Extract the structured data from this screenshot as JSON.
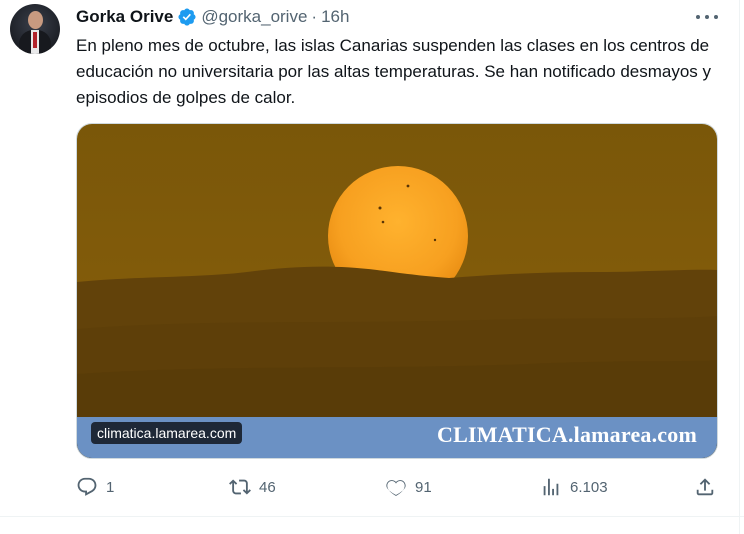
{
  "tweet": {
    "author_name": "Gorka Orive",
    "handle": "@gorka_orive",
    "separator": "·",
    "time": "16h",
    "text": "En pleno mes de octubre, las islas Canarias suspenden las clases en los centros de educación no universitaria por las altas temperaturas. Se han notificado desmayos y episodios de golpes de calor.",
    "verified": true
  },
  "media": {
    "domain_label": "climatica.lamarea.com",
    "brand_text": "CLIMATICA.lamarea.com",
    "colors": {
      "sky": "#7b5508",
      "sun": "#f7a020",
      "banner": "#6b91c4"
    }
  },
  "actions": {
    "reply_count": "1",
    "retweet_count": "46",
    "like_count": "91",
    "views_count": "6.103"
  },
  "icons": [
    "verified-badge-icon",
    "more-icon",
    "reply-icon",
    "retweet-icon",
    "like-icon",
    "views-icon",
    "share-icon"
  ]
}
